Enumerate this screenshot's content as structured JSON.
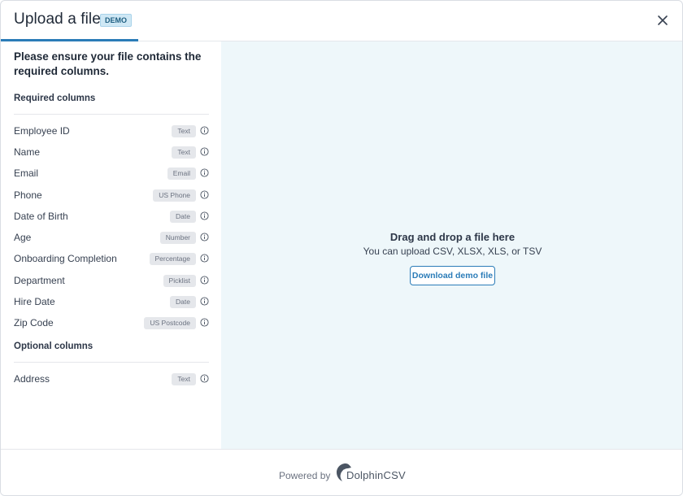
{
  "header": {
    "title": "Upload a file",
    "badge": "DEMO"
  },
  "left_panel": {
    "intro": "Please ensure your file contains the required columns.",
    "required_title": "Required columns",
    "required_columns": [
      {
        "label": "Employee ID",
        "type": "Text"
      },
      {
        "label": "Name",
        "type": "Text"
      },
      {
        "label": "Email",
        "type": "Email"
      },
      {
        "label": "Phone",
        "type": "US Phone"
      },
      {
        "label": "Date of Birth",
        "type": "Date"
      },
      {
        "label": "Age",
        "type": "Number"
      },
      {
        "label": "Onboarding Completion",
        "type": "Percentage"
      },
      {
        "label": "Department",
        "type": "Picklist"
      },
      {
        "label": "Hire Date",
        "type": "Date"
      },
      {
        "label": "Zip Code",
        "type": "US Postcode"
      }
    ],
    "optional_title": "Optional columns",
    "optional_columns": [
      {
        "label": "Address",
        "type": "Text"
      }
    ]
  },
  "dropzone": {
    "title": "Drag and drop a file here",
    "subtitle": "You can upload CSV, XLSX, XLS, or TSV",
    "download_label": "Download demo file"
  },
  "footer": {
    "powered_by": "Powered by",
    "brand": "DolphinCSV"
  },
  "icons": {
    "close": "close-icon",
    "info": "info-icon",
    "logo": "dolphin-logo-icon"
  },
  "colors": {
    "accent": "#2b7cb8",
    "dropzone_bg": "#eef7fa",
    "badge_bg": "#cfe8f5"
  }
}
